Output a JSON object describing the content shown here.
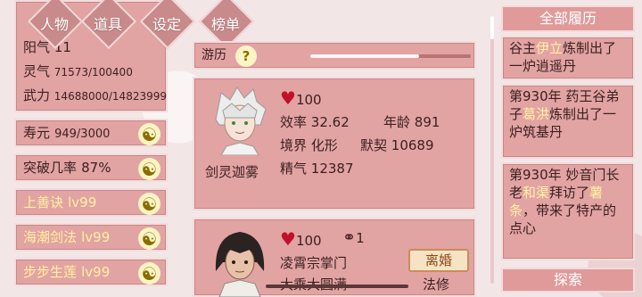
{
  "nav": [
    "人物",
    "道具",
    "设定",
    "榜单"
  ],
  "stats": {
    "yang_label": "阳气",
    "yang_value": "11",
    "ling_label": "灵气",
    "ling_value": "71573/100400",
    "wuli_label": "武力",
    "wuli_value": "14688000/14823999"
  },
  "rows": [
    {
      "label": "寿元",
      "value": "949/3000"
    },
    {
      "label": "突破几率",
      "value": "87%"
    },
    {
      "label": "上善诀",
      "value": "lv99"
    },
    {
      "label": "海潮剑法",
      "value": "lv99"
    },
    {
      "label": "步步生莲",
      "value": "lv99"
    }
  ],
  "travel": {
    "label": "游历",
    "help": "?",
    "progress": 0.68
  },
  "card1": {
    "name": "剑灵迦雾",
    "hp": "100",
    "efficiency_label": "效率",
    "efficiency": "32.62",
    "age_label": "年龄",
    "age": "891",
    "realm_label": "境界",
    "realm": "化形",
    "bond_label": "默契",
    "bond": "10689",
    "essence_label": "精气",
    "essence": "12387"
  },
  "card2": {
    "hp": "100",
    "rings": "1",
    "title": "凌霄宗掌门",
    "realm": "大乘大圆满",
    "divorce": "离婚",
    "path": "法修"
  },
  "history": {
    "title": "全部履历",
    "entries": [
      {
        "pre": "谷主",
        "hl": "伊立",
        "post": "炼制出了一炉逍遥丹"
      },
      {
        "pre": "第930年 药王谷弟子",
        "hl": "葛洪",
        "post": "炼制出了一炉筑基丹"
      },
      {
        "pre": "第930年 妙音门长老",
        "hl": "和渠",
        "post": "拜访了",
        "hl2": "薯条",
        "post2": "，带来了特产的点心"
      }
    ],
    "explore": "探索"
  },
  "colors": {
    "panel": "#e2a3a3",
    "highlight": "#fff2a2",
    "heart": "#c0102a"
  }
}
